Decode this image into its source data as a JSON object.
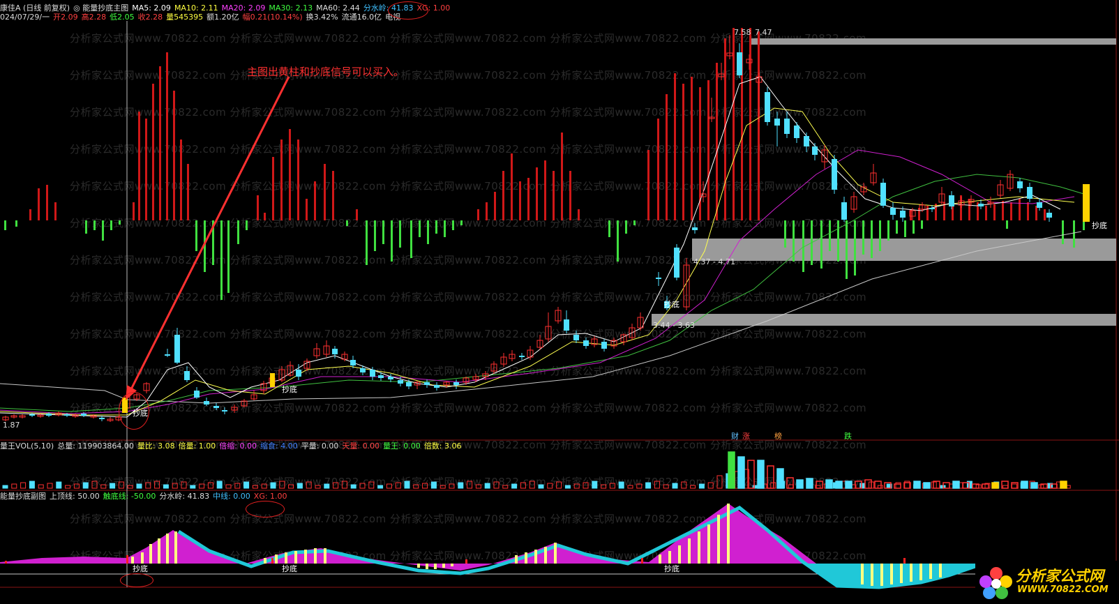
{
  "main_header": {
    "row1": [
      {
        "text": "康佳A (日线 前复权)",
        "color": "#dddddd"
      },
      {
        "text": "◎ 能量抄底主图",
        "color": "#dddddd"
      },
      {
        "text": "MA5: 2.09",
        "color": "#ffffff"
      },
      {
        "text": "MA10: 2.11",
        "color": "#ffff40"
      },
      {
        "text": "MA20: 2.09",
        "color": "#ff40ff"
      },
      {
        "text": "MA30: 2.13",
        "color": "#40ff40"
      },
      {
        "text": "MA60: 2.44",
        "color": "#dddddd"
      },
      {
        "text": "分水岭: 41.83",
        "color": "#40c0ff"
      },
      {
        "text": "XG: 1.00",
        "color": "#ff4040"
      }
    ],
    "row2": [
      {
        "text": "024/07/29/一",
        "color": "#dddddd"
      },
      {
        "text": "开2.09",
        "color": "#ff4040"
      },
      {
        "text": "高2.28",
        "color": "#ff4040"
      },
      {
        "text": "低2.05",
        "color": "#40ff40"
      },
      {
        "text": "收2.28",
        "color": "#ff4040"
      },
      {
        "text": "量545395",
        "color": "#ffff40"
      },
      {
        "text": "额1.20亿",
        "color": "#dddddd"
      },
      {
        "text": "幅0.21(10.14%)",
        "color": "#ff4040"
      },
      {
        "text": "换3.42%",
        "color": "#dddddd"
      },
      {
        "text": "流通16.0亿",
        "color": "#dddddd"
      },
      {
        "text": "电视",
        "color": "#dddddd"
      }
    ]
  },
  "annotation": "主图出黄柱和抄底信号可以买入。",
  "price_labels": {
    "low": "1.87",
    "high": "7.58",
    "high_b": "7.47",
    "zone_mid": "4.37 - 4.71",
    "zone_low": "3.44 - 3.63"
  },
  "signal_label": "抄底",
  "flags": {
    "cai": "财",
    "zhang": "涨",
    "bang": "榜",
    "die": "跌"
  },
  "vol_header": [
    {
      "text": "量王VOL(5,10)",
      "color": "#dddddd"
    },
    {
      "text": "总量: 119903864.00",
      "color": "#dddddd"
    },
    {
      "text": "量比: 3.08",
      "color": "#ffff40"
    },
    {
      "text": "倍量: 1.00",
      "color": "#ffff40"
    },
    {
      "text": "倍缩: 0.00",
      "color": "#ff40ff"
    },
    {
      "text": "缩食: 4.00",
      "color": "#4080ff"
    },
    {
      "text": "平量: 0.00",
      "color": "#dddddd"
    },
    {
      "text": "天量: 0.00",
      "color": "#ff4040"
    },
    {
      "text": "量王: 0.00",
      "color": "#40ff40"
    },
    {
      "text": "倍数: 3.06",
      "color": "#ffff40"
    }
  ],
  "sub_header": [
    {
      "text": "能量抄底副图",
      "color": "#dddddd"
    },
    {
      "text": "上顶线: 50.00",
      "color": "#dddddd"
    },
    {
      "text": "触底线: -50.00",
      "color": "#40ff40"
    },
    {
      "text": "分水岭: 41.83",
      "color": "#dddddd"
    },
    {
      "text": "中线: 0.00",
      "color": "#40c0ff"
    },
    {
      "text": "XG: 1.00",
      "color": "#ff4040"
    }
  ],
  "watermark": "分析家公式网www.70822.com",
  "logo": {
    "name": "分析家公式网",
    "url": "WWW.70822.COM"
  },
  "colors": {
    "up": "#ff3030",
    "down": "#50e0ff",
    "pos_bar": "#d01818",
    "neg_bar": "#40e040",
    "sub_magenta": "#d020d0",
    "sub_cyan": "#20c8d8",
    "sub_yellow": "#ffff80"
  }
}
